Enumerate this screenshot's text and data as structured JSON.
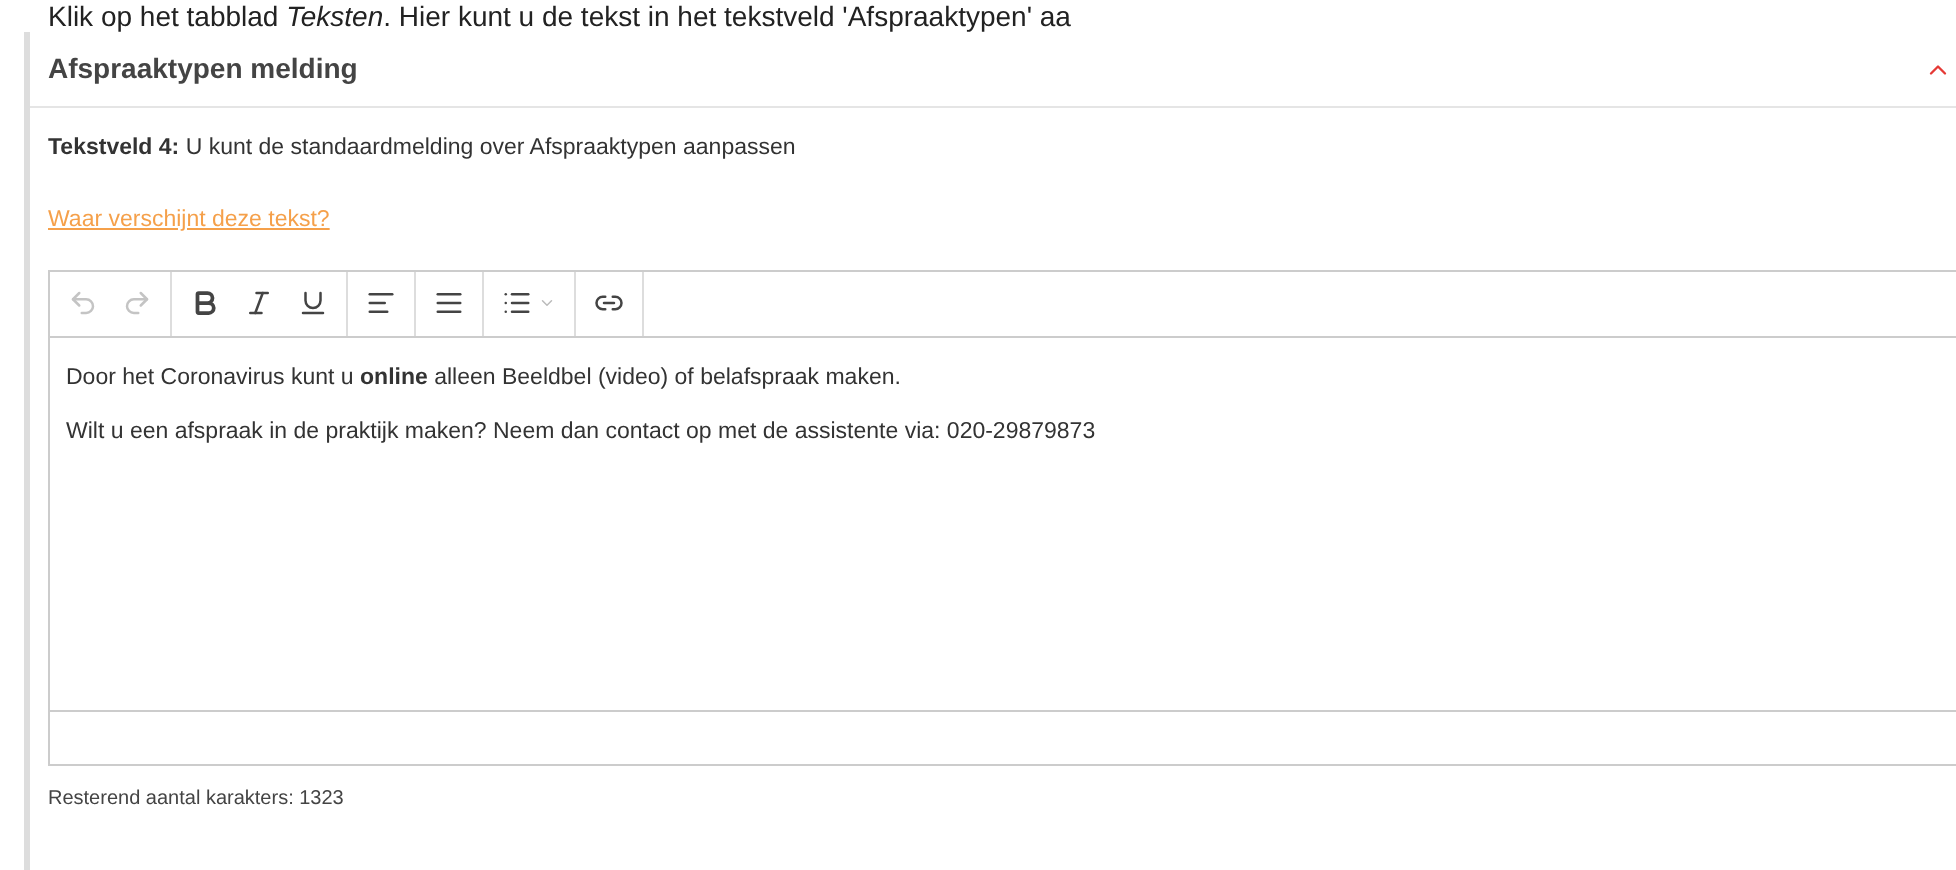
{
  "intro": "Klik op het tabblad *Teksten*. Hier kunt u de tekst in het tekstveld 'Afspraaktypen' aa",
  "panel": {
    "title": "Afspraaktypen melding",
    "expanded": true,
    "field_label": "Tekstveld 4:",
    "field_description": "U kunt de standaardmelding over Afspraaktypen aanpassen",
    "help_link": "Waar verschijnt deze tekst?",
    "toolbar": [
      [
        {
          "kind": "undo",
          "disabled": true
        },
        {
          "kind": "redo",
          "disabled": true
        }
      ],
      [
        {
          "kind": "bold",
          "disabled": false
        },
        {
          "kind": "italic",
          "disabled": false
        },
        {
          "kind": "underline",
          "disabled": false
        }
      ],
      [
        {
          "kind": "align-left",
          "disabled": false
        }
      ],
      [
        {
          "kind": "justify",
          "disabled": false
        }
      ],
      [
        {
          "kind": "bullet-list",
          "disabled": false
        }
      ],
      [
        {
          "kind": "link",
          "disabled": false
        }
      ]
    ],
    "content": [
      "Door het Coronavirus kunt u **online** alleen Beeldbel (video) of belafspraak maken.",
      "Wilt u een afspraak in de praktijk maken? Neem dan contact op met de assistente via: 020-29879873"
    ],
    "counter": "Resterend aantal karakters: 1323"
  }
}
